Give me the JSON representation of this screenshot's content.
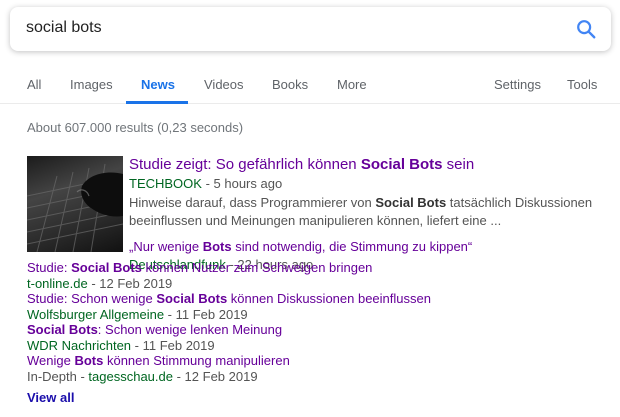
{
  "search": {
    "query": "social bots"
  },
  "tabs": [
    {
      "label": "All",
      "active": false
    },
    {
      "label": "Images",
      "active": false
    },
    {
      "label": "News",
      "active": true
    },
    {
      "label": "Videos",
      "active": false
    },
    {
      "label": "Books",
      "active": false
    },
    {
      "label": "More",
      "active": false
    }
  ],
  "tools": {
    "settings_label": "Settings",
    "tools_label": "Tools"
  },
  "result_stats": "About 607.000 results (0,23 seconds)",
  "top_story": {
    "title_before": "Studie zeigt: So gefährlich können ",
    "title_bold": "Social Bots",
    "title_after": " sein",
    "source": "TECHBOOK",
    "date": " - 5 hours ago",
    "snippet_before": "Hinweise darauf, dass Programmierer von ",
    "snippet_bold": "Social Bots",
    "snippet_after": " tatsächlich Diskussionen beeinflussen und Meinungen manipulieren können, liefert eine ...",
    "related_before": "„Nur wenige ",
    "related_bold": "Bots",
    "related_after": " sind notwendig, die Stimmung zu kippen“",
    "related_source": "Deutschlandfunk",
    "related_date": " - 22 hours ago"
  },
  "more_stories": [
    {
      "before": "Studie: ",
      "bold": "Social Bots",
      "after": " können Nutzer zum Schweigen bringen",
      "prefix": "",
      "source": "t-online.de",
      "date": " - 12 Feb 2019"
    },
    {
      "before": "Studie: Schon wenige ",
      "bold": "Social Bots",
      "after": " können Diskussionen beeinflussen",
      "prefix": "",
      "source": "Wolfsburger Allgemeine",
      "date": " - 11 Feb 2019"
    },
    {
      "before": "",
      "bold": "Social Bots",
      "after": ": Schon wenige lenken Meinung",
      "prefix": "",
      "source": "WDR Nachrichten",
      "date": " - 11 Feb 2019"
    },
    {
      "before": "Wenige ",
      "bold": "Bots",
      "after": " können Stimmung manipulieren",
      "prefix": "In-Depth - ",
      "source": "tagesschau.de",
      "date": " - 12 Feb 2019"
    }
  ],
  "view_all_label": "View all",
  "colors": {
    "accent": "#1a73e8",
    "visited_link": "#660099",
    "source_green": "#006621",
    "link": "#1a0dab"
  }
}
